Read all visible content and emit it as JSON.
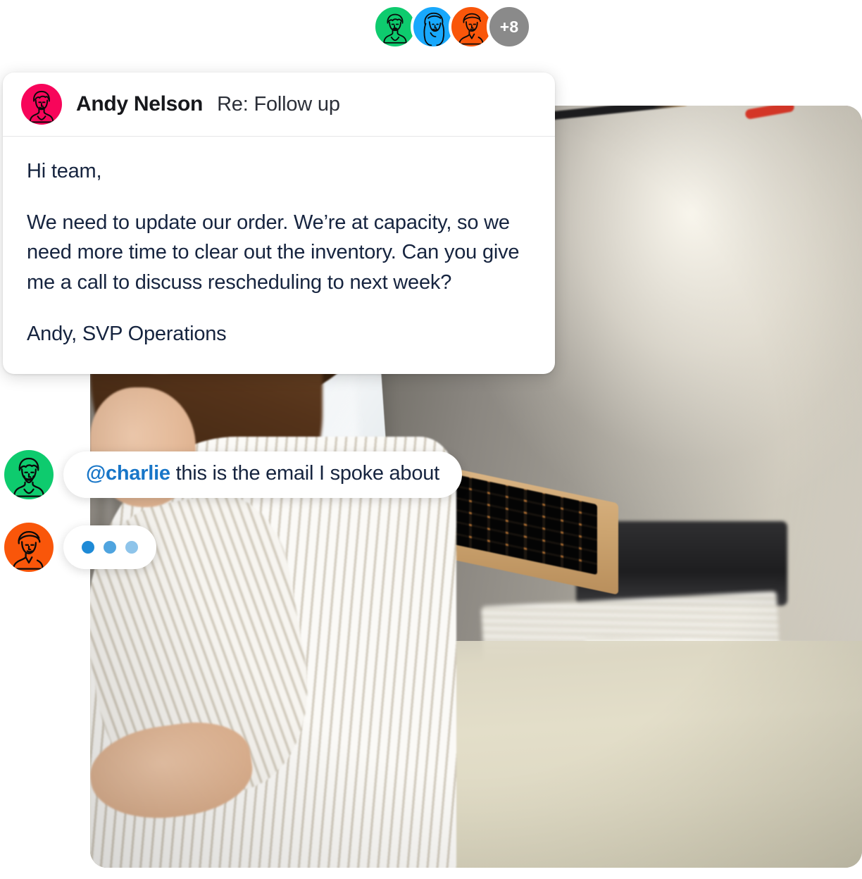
{
  "avatar_group": {
    "name": "participants",
    "avatars": [
      {
        "id": "avatar-green",
        "icon": "person-curly-hair-icon",
        "color": "#0ECB6E",
        "label": ""
      },
      {
        "id": "avatar-blue",
        "icon": "person-long-hair-icon",
        "color": "#18A8FC",
        "label": ""
      },
      {
        "id": "avatar-orange",
        "icon": "person-short-hair-icon",
        "color": "#F9560A",
        "label": ""
      }
    ],
    "overflow": {
      "id": "avatar-more",
      "label": "+8",
      "color": "#8A8A8A",
      "text_color": "#FFFFFF"
    }
  },
  "email": {
    "avatar": {
      "icon": "person-avatar-icon",
      "color": "#F7055A"
    },
    "sender": "Andy Nelson",
    "subject": "Re: Follow up",
    "body": [
      "Hi team,",
      "We need to update our order. We’re at capacity, so we need more time to clear out the inventory. Can you give me a call to discuss rescheduling to next week?",
      "Andy, SVP Operations"
    ],
    "text_color": "#16243F"
  },
  "chat": {
    "mention_message": {
      "avatar": {
        "icon": "person-beard-icon",
        "color": "#0ECB6E"
      },
      "mention": "@charlie",
      "mention_color": "#1876C8",
      "text": " this is the email I spoke about"
    },
    "typing_message": {
      "avatar": {
        "icon": "person-short-hair-icon",
        "color": "#F9560A"
      },
      "status": "typing",
      "dot_color": "#1E8AD6",
      "dot_count": 3
    }
  },
  "photo": {
    "alt": "Woman with glasses at desk working on a laptop in an office",
    "corner_radius_px": 24
  }
}
